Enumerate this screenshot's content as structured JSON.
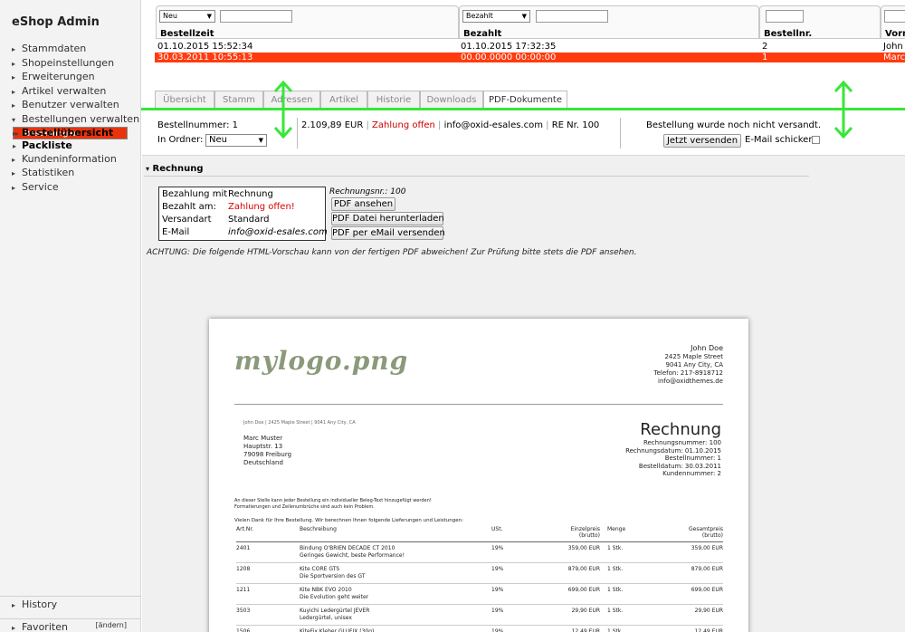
{
  "sidebar": {
    "brand": "eShop Admin",
    "items": [
      "Stammdaten",
      "Shopeinstellungen",
      "Erweiterungen",
      "Artikel verwalten",
      "Benutzer verwalten",
      "Bestellungen verwalten",
      "Bestellungen",
      "Bestellübersicht",
      "Packliste",
      "Kundeninformation",
      "Statistiken",
      "Service"
    ],
    "history": "History",
    "favorites": "Favoriten",
    "change": "[ändern]"
  },
  "filters": {
    "status1": "Neu",
    "status2": "Bezahlt",
    "col1": "Bestellzeit",
    "col2": "Bezahlt",
    "col3": "Bestellnr.",
    "col4": "Vorna"
  },
  "rows": [
    [
      "01.10.2015 15:52:34",
      "01.10.2015 17:32:35",
      "2",
      "John"
    ],
    [
      "30.03.2011 10:55:13",
      "00.00.0000 00:00:00",
      "1",
      "Marc"
    ]
  ],
  "tabs": [
    "Übersicht",
    "Stamm",
    "Adressen",
    "Artikel",
    "Historie",
    "Downloads",
    "PDF-Dokumente"
  ],
  "details": {
    "ordernr": "Bestellnummer: 1",
    "folder_label": "In Ordner:",
    "folder": "Neu",
    "amount": "2.109,89 EUR",
    "sep1": "|",
    "payment": "Zahlung offen",
    "sep2": "|",
    "email": "info@oxid-esales.com",
    "sep3": "|",
    "re": "RE Nr. 100",
    "notsent": "Bestellung wurde noch nicht versandt.",
    "send_btn": "Jetzt versenden",
    "mail_q": "E-Mail schicken?"
  },
  "invoice": {
    "section": "Rechnung",
    "rows": [
      [
        "Bezahlung mit",
        "Rechnung"
      ],
      [
        "Bezahlt am:",
        "Zahlung offen!"
      ],
      [
        "Versandart",
        "Standard"
      ],
      [
        "E-Mail",
        "info@oxid-esales.com"
      ]
    ],
    "rnr": "Rechnungsnr.: 100",
    "btn1": "PDF ansehen",
    "btn2": "PDF Datei herunterladen",
    "btn3": "PDF per eMail versenden",
    "warning": "ACHTUNG: Die folgende HTML-Vorschau kann von der fertigen PDF abweichen! Zur Prüfung bitte stets die PDF ansehen."
  },
  "pdf": {
    "logo": "mylogo.png",
    "shop": [
      "John Doe",
      "2425 Maple Street",
      "9041 Any City, CA",
      "Telefon: 217-8918712",
      "info@oxidthemes.de"
    ],
    "sender": "John Doe | 2425 Maple Street | 9041 Any City, CA",
    "addr": [
      "Marc Muster",
      "Hauptstr. 13",
      "79098 Freiburg",
      "Deutschland"
    ],
    "title": "Rechnung",
    "meta": [
      "Rechnungsnummer:  100",
      "Rechnungsdatum:  01.10.2015",
      "Bestellnummer:  1",
      "Bestelldatum:  30.03.2011",
      "Kundennummer:  2"
    ],
    "note1": "An dieser Stelle kann jeder Bestellung ein individueller Beleg-Text hinzugefügt werden!",
    "note2": "Formatierungen und Zeilenumbrüche sind auch kein Problem.",
    "thanks": "Vielen Dank für Ihre Bestellung. Wir berechnen Ihnen folgende Lieferungen und Leistungen:",
    "head": [
      "Art.Nr.",
      "Beschreibung",
      "USt.",
      "Einzelpreis",
      "(brutto)",
      "Menge",
      "Gesamtpreis",
      "(brutto)"
    ],
    "items": [
      [
        "2401",
        "Bindung O'BRIEN DECADE CT 2010",
        "Geringes Gewicht, beste Performance!",
        "19%",
        "359,00 EUR",
        "1 Stk.",
        "359,00 EUR"
      ],
      [
        "1208",
        "Kite CORE GTS",
        "Die Sportversion des GT",
        "19%",
        "879,00 EUR",
        "1 Stk.",
        "879,00 EUR"
      ],
      [
        "1211",
        "Kite NBK EVO 2010",
        "Die Evolution geht weiter",
        "19%",
        "699,00 EUR",
        "1 Stk.",
        "699,00 EUR"
      ],
      [
        "3503",
        "Kuyichi Ledergürtel JEVER",
        "Ledergürtel, unisex",
        "19%",
        "29,90 EUR",
        "1 Stk.",
        "29,90 EUR"
      ],
      [
        "1506",
        "KiteFix Kleber GLUFIX (30g)",
        "",
        "19%",
        "12,49 EUR",
        "1 Stk.",
        "12,49 EUR"
      ]
    ]
  }
}
